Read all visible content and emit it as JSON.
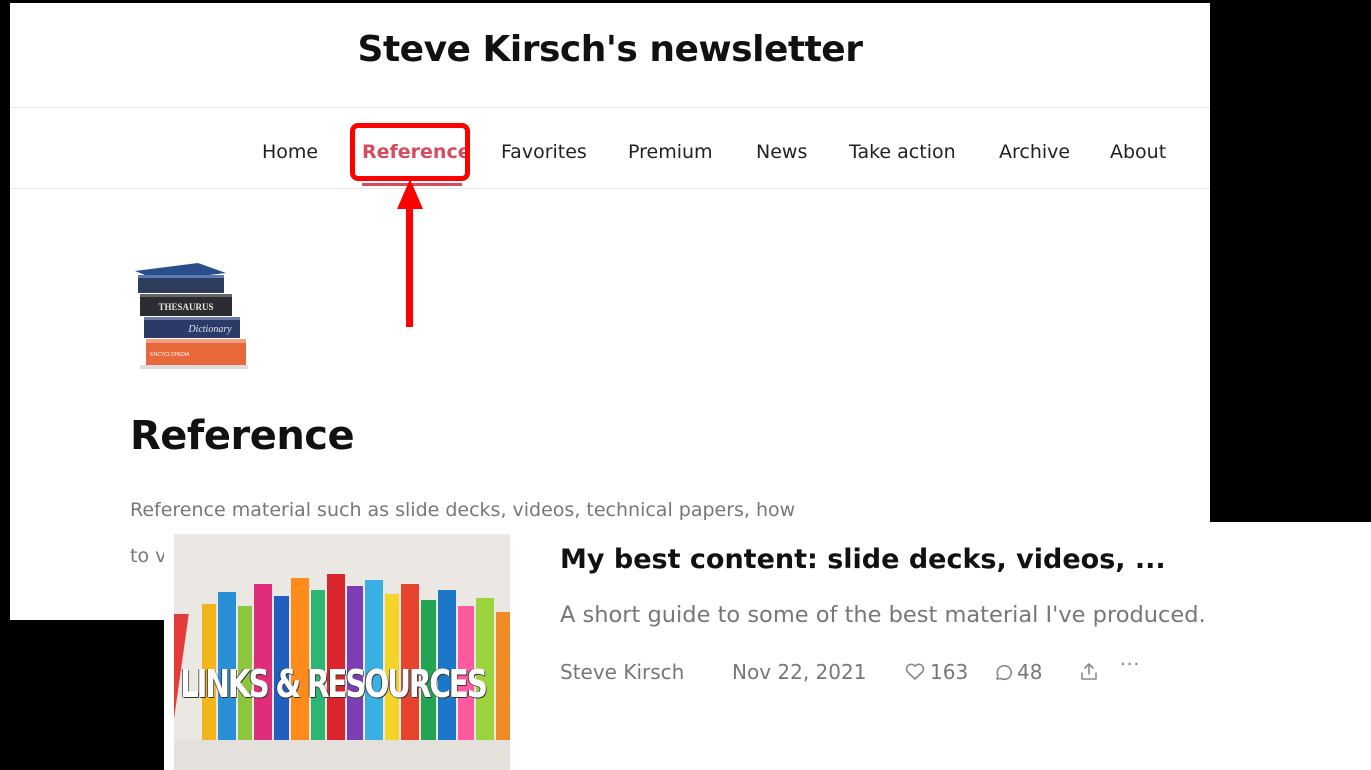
{
  "newsletter": {
    "title": "Steve Kirsch's newsletter",
    "nav": [
      {
        "label": "Home"
      },
      {
        "label": "Reference",
        "active": true
      },
      {
        "label": "Favorites"
      },
      {
        "label": "Premium"
      },
      {
        "label": "News"
      },
      {
        "label": "Take action"
      },
      {
        "label": "Archive"
      },
      {
        "label": "About"
      }
    ],
    "accent_color": "#d74b5f",
    "annotation_color": "#ff0000"
  },
  "section": {
    "icon": "books-stack-icon",
    "icon_books": [
      "THESAURUS",
      "Dictionary",
      "ENCYCLOPEDIA"
    ],
    "heading": "Reference",
    "description": "Reference material such as slide decks, videos, technical papers, how",
    "description_cont": "to v"
  },
  "post": {
    "thumbnail_text": "LINKS & RESOURCES",
    "title": "My best content: slide decks, videos, ...",
    "subtitle": "A short guide to some of the best material I've produced.",
    "author": "Steve Kirsch",
    "date": "Nov 22, 2021",
    "likes": "163",
    "comments": "48",
    "share_icon": "share-icon",
    "more_icon": "more-icon",
    "more_label": "···"
  }
}
